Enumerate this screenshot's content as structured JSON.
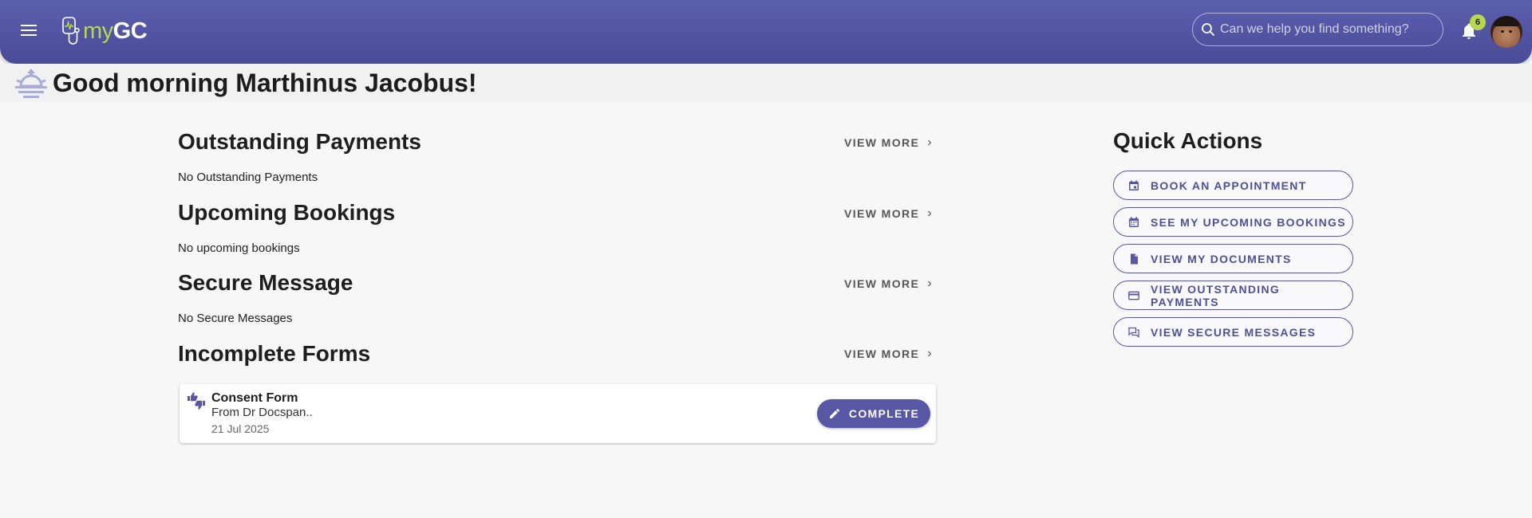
{
  "header": {
    "logo": {
      "prefix": "my",
      "suffix": "GC"
    },
    "search": {
      "placeholder": "Can we help you find something?"
    },
    "notifications": {
      "count": "6"
    },
    "colors": {
      "bar": "#4f519f",
      "accent": "#b6d84a"
    }
  },
  "greeting": "Good morning Marthinus Jacobus!",
  "sections": [
    {
      "title": "Outstanding Payments",
      "view_more": "VIEW MORE",
      "empty_text": "No Outstanding Payments"
    },
    {
      "title": "Upcoming Bookings",
      "view_more": "VIEW MORE",
      "empty_text": "No upcoming bookings"
    },
    {
      "title": "Secure Message",
      "view_more": "VIEW MORE",
      "empty_text": "No Secure Messages"
    },
    {
      "title": "Incomplete Forms",
      "view_more": "VIEW MORE"
    }
  ],
  "incomplete_forms": [
    {
      "name": "Consent Form",
      "from": "From Dr Docspan..",
      "date": "21 Jul 2025",
      "action": "COMPLETE"
    }
  ],
  "quick_actions": {
    "title": "Quick Actions",
    "items": [
      {
        "label": "BOOK AN APPOINTMENT",
        "icon": "calendar-plus-icon"
      },
      {
        "label": "SEE MY UPCOMING BOOKINGS",
        "icon": "calendar-icon"
      },
      {
        "label": "VIEW MY DOCUMENTS",
        "icon": "document-icon"
      },
      {
        "label": "VIEW OUTSTANDING PAYMENTS",
        "icon": "credit-card-icon"
      },
      {
        "label": "VIEW SECURE MESSAGES",
        "icon": "chat-icon"
      }
    ]
  }
}
